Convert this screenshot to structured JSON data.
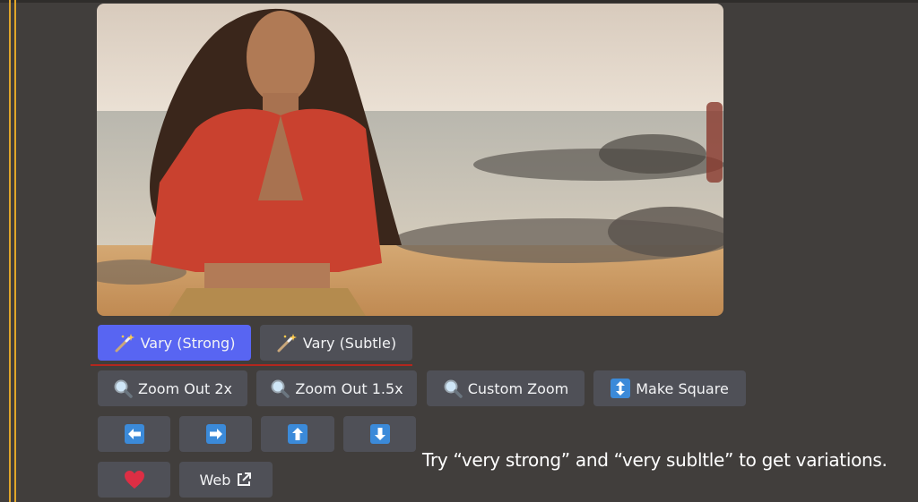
{
  "image": {
    "subject": "woman-on-beach-photo"
  },
  "row1": {
    "vary_strong": {
      "label": "Vary (Strong)",
      "icon": "magic-wand-icon"
    },
    "vary_subtle": {
      "label": "Vary (Subtle)",
      "icon": "magic-wand-icon"
    }
  },
  "row2": {
    "zoom_out_2x": {
      "label": "Zoom Out 2x",
      "icon": "magnifier-icon"
    },
    "zoom_out_15x": {
      "label": "Zoom Out 1.5x",
      "icon": "magnifier-icon"
    },
    "custom_zoom": {
      "label": "Custom Zoom",
      "icon": "magnifier-icon"
    },
    "make_square": {
      "label": "Make Square",
      "icon": "up-down-arrow-icon"
    }
  },
  "row3": {
    "pan_left": {
      "icon": "arrow-left-icon"
    },
    "pan_right": {
      "icon": "arrow-right-icon"
    },
    "pan_up": {
      "icon": "arrow-up-icon"
    },
    "pan_down": {
      "icon": "arrow-down-icon"
    }
  },
  "row4": {
    "favorite": {
      "icon": "heart-icon"
    },
    "web": {
      "label": "Web",
      "icon": "external-link-icon"
    }
  },
  "caption": {
    "text": "Try “very strong” and “very subltle” to get variations."
  },
  "colors": {
    "background": "#413e3c",
    "button": "#4f5057",
    "primary": "#5865f2",
    "accent_gold": "#e0a52a",
    "arrow_blue": "#3b8ad9",
    "heart_red": "#dd2e44"
  }
}
